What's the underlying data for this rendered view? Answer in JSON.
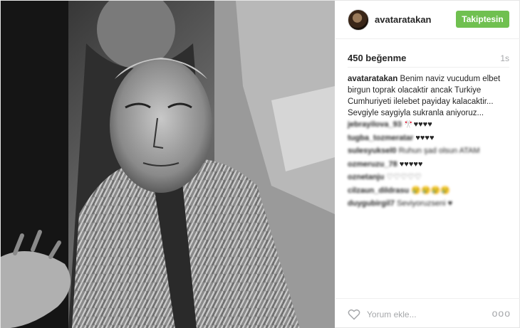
{
  "post": {
    "username": "avataratakan",
    "follow_label": "Takiptesin",
    "likes": "450 beğenme",
    "time": "1s",
    "caption_user": "avataratakan",
    "caption_text": "Benim naviz vucudum elbet birgun toprak olacaktir ancak Turkiye Cumhuriyeti ilelebet payiday kalacaktir... Sevgiyle saygiyla sukranla aniyoruz...",
    "comments": [
      {
        "user": "jebrayilova_93",
        "text": "🎌♥♥♥♥"
      },
      {
        "user": "tugba_tozmeratar",
        "text": "♥♥♥♥"
      },
      {
        "user": "sulesyuksel0",
        "text": "Ruhun şad olsun ATAM"
      },
      {
        "user": "ozmeruzu_78",
        "text": "♥♥♥♥♥"
      },
      {
        "user": "oznetanju",
        "text": "♡♡♡♡♡"
      },
      {
        "user": "cilzaun_dildrasu",
        "text": "😢😢😢😢"
      },
      {
        "user": "duygubirgil7",
        "text": "Seviyoruzseni ♥"
      }
    ],
    "comment_placeholder": "Yorum ekle...",
    "more_label": "ooo"
  },
  "icons": {
    "heart": "heart-icon",
    "more": "more-options-icon"
  },
  "colors": {
    "follow_button": "#70c050",
    "muted_text": "#a5a7aa",
    "text": "#262626"
  }
}
